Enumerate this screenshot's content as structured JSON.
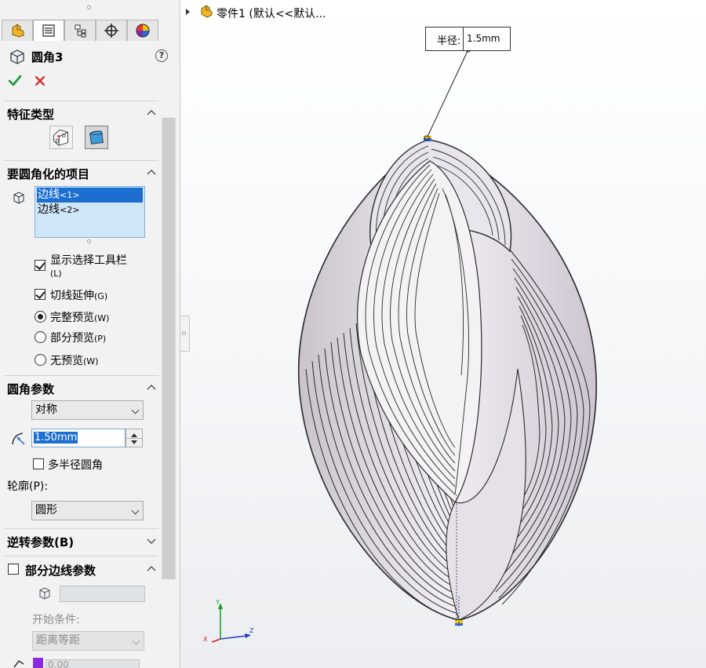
{
  "window": {
    "part_title": "零件1  (默认<<默认..."
  },
  "panel": {
    "tabs": [
      {
        "icon": "feature-manager-icon"
      },
      {
        "icon": "property-manager-icon"
      },
      {
        "icon": "configuration-manager-icon"
      },
      {
        "icon": "dimxpert-icon"
      },
      {
        "icon": "display-manager-icon"
      }
    ],
    "feature_title": "圆角3",
    "help": "?",
    "sections": {
      "feature_type": {
        "title": "特征类型"
      },
      "items_to_fillet": {
        "title": "要圆角化的项目",
        "edges": [
          {
            "name": "边线",
            "suffix": "<1>",
            "selected": true
          },
          {
            "name": "边线",
            "suffix": "<2>",
            "selected": false
          }
        ],
        "show_selection_toolbar": {
          "label": "显示选择工具栏",
          "shortcut": "(L)",
          "checked": true
        },
        "tangent_propagation": {
          "label": "切线延伸",
          "shortcut": "(G)",
          "checked": true
        },
        "preview_options": [
          {
            "label": "完整预览",
            "shortcut": "(W)",
            "checked": true
          },
          {
            "label": "部分预览",
            "shortcut": "(P)",
            "checked": false
          },
          {
            "label": "无预览",
            "shortcut": "(W)",
            "checked": false
          }
        ]
      },
      "fillet_params": {
        "title": "圆角参数",
        "method": "对称",
        "radius": "1.50mm",
        "multi_radius": {
          "label": "多半径圆角",
          "checked": false
        },
        "profile_label": "轮廓(P):",
        "profile_value": "圆形"
      },
      "setback_params": {
        "title": "逆转参数(B)"
      },
      "partial_edge": {
        "title": "部分边线参数",
        "checked": false,
        "start_condition_label": "开始条件:",
        "start_condition_value": "距离等距",
        "bottom_value": "0.00"
      }
    }
  },
  "viewport": {
    "callout": {
      "label": "半径:",
      "value": "1.5mm"
    },
    "triad": {
      "x": "X",
      "y": "Y",
      "z": "Z"
    }
  },
  "colors": {
    "accent_blue": "#1c6fd1",
    "ok_green": "#1a9a2a",
    "cancel_red": "#d42020",
    "model_fill": "#d9d4dc",
    "model_edges": "#2a2a2a"
  }
}
